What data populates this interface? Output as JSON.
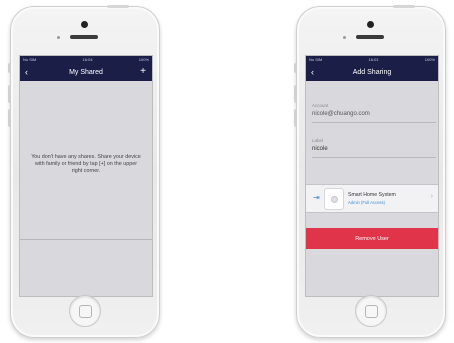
{
  "left_screen": {
    "status": {
      "carrier": "No SIM",
      "time": "16:04",
      "battery": "100%"
    },
    "title": "My Shared",
    "back_icon": "chevron-left-icon",
    "add_icon": "plus-icon",
    "add_symbol": "+",
    "back_symbol": "‹",
    "empty_message": "You don't have any shares. Share your device with family or friend by tap [+] on the upper right corner."
  },
  "right_screen": {
    "status": {
      "carrier": "No SIM",
      "time": "16:01",
      "battery": "100%"
    },
    "title": "Add Sharing",
    "back_symbol": "‹",
    "account_label": "Account",
    "account_value": "nicole@chuango.com",
    "label_label": "Label",
    "label_value": "nicole",
    "device_name": "Smart Home System",
    "device_access": "Admin (Full Access)",
    "exit_icon": "exit-icon",
    "exit_symbol": "⇥",
    "chevron_symbol": "›",
    "remove_button": "Remove User",
    "colors": {
      "nav": "#1b1f47",
      "remove": "#e0344a",
      "link": "#3f8fd6"
    }
  }
}
